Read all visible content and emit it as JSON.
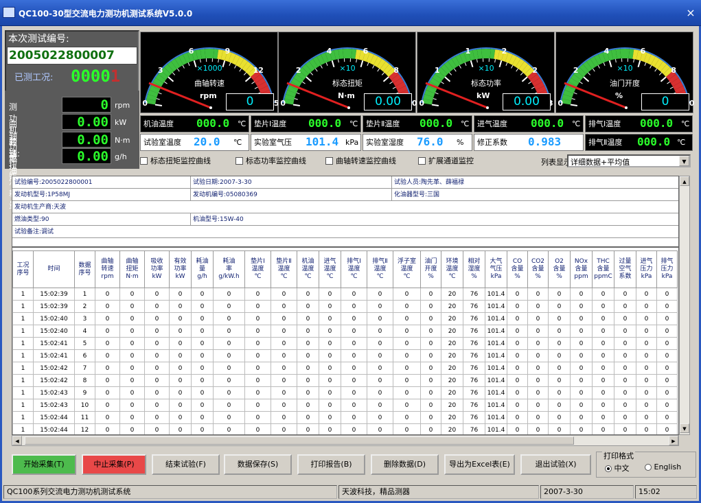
{
  "window": {
    "title": "QC100-30型交流电力测功机测试系统V5.0.0",
    "close": "×"
  },
  "left": {
    "test_no_label": "本次测试编号:",
    "test_no": "2005022800007",
    "tested_label": "已测工况:",
    "tested_value": "0000",
    "tested_last_digit": "1",
    "meters": [
      {
        "label": "测功机转速:",
        "value": "0",
        "unit": "rpm"
      },
      {
        "label": "曲轴功率",
        "value": "0.00",
        "unit": "kW"
      },
      {
        "label": "曲轴扭矩",
        "value": "0.00",
        "unit": "N·m"
      },
      {
        "label": "燃油消耗量:",
        "value": "0.00",
        "unit": "g/h"
      }
    ]
  },
  "gauges": [
    {
      "multiplier": "×1000",
      "name": "曲轴转速",
      "unit": "rpm",
      "value": "0",
      "ticks": [
        "0",
        "3",
        "6",
        "9",
        "12",
        "15"
      ]
    },
    {
      "multiplier": "×10",
      "name": "标态扭矩",
      "unit": "N·m",
      "value": "0.00",
      "ticks": [
        "0",
        "2",
        "4",
        "6",
        "8",
        "10"
      ]
    },
    {
      "multiplier": "×10",
      "name": "标态功率",
      "unit": "kW",
      "value": "0.00",
      "ticks": [
        "0",
        "1",
        "1",
        "2",
        "2",
        "3"
      ]
    },
    {
      "multiplier": "×10",
      "name": "油门开度",
      "unit": "%",
      "value": "0",
      "ticks": [
        "0",
        "2",
        "4",
        "6",
        "8",
        "10"
      ]
    }
  ],
  "readouts_row1": [
    {
      "label": "机油温度",
      "value": "000.0",
      "unit": "℃"
    },
    {
      "label": "垫片Ⅰ温度",
      "value": "000.0",
      "unit": "℃"
    },
    {
      "label": "垫片Ⅱ温度",
      "value": "000.0",
      "unit": "℃"
    },
    {
      "label": "进气温度",
      "value": "000.0",
      "unit": "℃"
    },
    {
      "label": "排气Ⅰ温度",
      "value": "000.0",
      "unit": "℃"
    }
  ],
  "readouts_row2": [
    {
      "label": "试验室温度",
      "value": "20.0",
      "unit": "℃"
    },
    {
      "label": "实验室气压",
      "value": "101.4",
      "unit": "kPa"
    },
    {
      "label": "实验室湿度",
      "value": "76.0",
      "unit": "%"
    },
    {
      "label": "修正系数",
      "value": "0.983",
      "unit": ""
    },
    {
      "label": "排气Ⅱ温度",
      "value": "000.0",
      "unit": "℃"
    }
  ],
  "checks": [
    "标态扭矩监控曲线",
    "标态功率监控曲线",
    "曲轴转速监控曲线",
    "扩展通道监控"
  ],
  "list_display": {
    "label": "列表显示:",
    "value": "详细数据+平均值"
  },
  "info": {
    "test_no": "试验编号:2005022800001",
    "date": "试验日期:2007-3-30",
    "staff": "试验人员:陶先革、薛福禄",
    "engine_model": "发动机型号:1P58MJ",
    "engine_no": "发动机编号:05080369",
    "carb": "化油器型号:三国",
    "maker": "发动机生产商:天波",
    "fuel": "燃油类型:90",
    "oil": "机油型号:15W-40",
    "note": "试验备注:调试"
  },
  "table": {
    "headers": [
      "工况\n序号",
      "时间",
      "数据\n序号",
      "曲轴\n转速\nrpm",
      "曲轴\n扭矩\nN·m",
      "吸收\n功率\nkW",
      "有效\n功率\nkW",
      "耗油\n量\ng/h",
      "耗油\n率\ng/kW.h",
      "垫片Ⅰ\n温度\n℃",
      "垫片Ⅱ\n温度\n℃",
      "机油\n温度\n℃",
      "进气\n温度\n℃",
      "排气Ⅰ\n温度\n℃",
      "排气Ⅱ\n温度\n℃",
      "浮子室\n温度\n℃",
      "油门\n开度\n%",
      "环境\n温度\n℃",
      "相对\n湿度\n%",
      "大气\n气压\nkPa",
      "CO\n含量\n%",
      "CO2\n含量\n%",
      "O2\n含量\n%",
      "NOx\n含量\nppm",
      "THC\n含量\nppmC",
      "过量\n空气\n系数",
      "进气\n压力\nkPa",
      "排气\n压力\nkPa"
    ],
    "rows": [
      [
        "1",
        "15:02:39",
        "1",
        "0",
        "0",
        "0",
        "0",
        "0",
        "0",
        "0",
        "0",
        "0",
        "0",
        "0",
        "0",
        "0",
        "0",
        "20",
        "76",
        "101.4",
        "0",
        "0",
        "0",
        "0",
        "0",
        "0",
        "0",
        "0"
      ],
      [
        "1",
        "15:02:39",
        "2",
        "0",
        "0",
        "0",
        "0",
        "0",
        "0",
        "0",
        "0",
        "0",
        "0",
        "0",
        "0",
        "0",
        "0",
        "20",
        "76",
        "101.4",
        "0",
        "0",
        "0",
        "0",
        "0",
        "0",
        "0",
        "0"
      ],
      [
        "1",
        "15:02:40",
        "3",
        "0",
        "0",
        "0",
        "0",
        "0",
        "0",
        "0",
        "0",
        "0",
        "0",
        "0",
        "0",
        "0",
        "0",
        "20",
        "76",
        "101.4",
        "0",
        "0",
        "0",
        "0",
        "0",
        "0",
        "0",
        "0"
      ],
      [
        "1",
        "15:02:40",
        "4",
        "0",
        "0",
        "0",
        "0",
        "0",
        "0",
        "0",
        "0",
        "0",
        "0",
        "0",
        "0",
        "0",
        "0",
        "20",
        "76",
        "101.4",
        "0",
        "0",
        "0",
        "0",
        "0",
        "0",
        "0",
        "0"
      ],
      [
        "1",
        "15:02:41",
        "5",
        "0",
        "0",
        "0",
        "0",
        "0",
        "0",
        "0",
        "0",
        "0",
        "0",
        "0",
        "0",
        "0",
        "0",
        "20",
        "76",
        "101.4",
        "0",
        "0",
        "0",
        "0",
        "0",
        "0",
        "0",
        "0"
      ],
      [
        "1",
        "15:02:41",
        "6",
        "0",
        "0",
        "0",
        "0",
        "0",
        "0",
        "0",
        "0",
        "0",
        "0",
        "0",
        "0",
        "0",
        "0",
        "20",
        "76",
        "101.4",
        "0",
        "0",
        "0",
        "0",
        "0",
        "0",
        "0",
        "0"
      ],
      [
        "1",
        "15:02:42",
        "7",
        "0",
        "0",
        "0",
        "0",
        "0",
        "0",
        "0",
        "0",
        "0",
        "0",
        "0",
        "0",
        "0",
        "0",
        "20",
        "76",
        "101.4",
        "0",
        "0",
        "0",
        "0",
        "0",
        "0",
        "0",
        "0"
      ],
      [
        "1",
        "15:02:42",
        "8",
        "0",
        "0",
        "0",
        "0",
        "0",
        "0",
        "0",
        "0",
        "0",
        "0",
        "0",
        "0",
        "0",
        "0",
        "20",
        "76",
        "101.4",
        "0",
        "0",
        "0",
        "0",
        "0",
        "0",
        "0",
        "0"
      ],
      [
        "1",
        "15:02:43",
        "9",
        "0",
        "0",
        "0",
        "0",
        "0",
        "0",
        "0",
        "0",
        "0",
        "0",
        "0",
        "0",
        "0",
        "0",
        "20",
        "76",
        "101.4",
        "0",
        "0",
        "0",
        "0",
        "0",
        "0",
        "0",
        "0"
      ],
      [
        "1",
        "15:02:43",
        "10",
        "0",
        "0",
        "0",
        "0",
        "0",
        "0",
        "0",
        "0",
        "0",
        "0",
        "0",
        "0",
        "0",
        "0",
        "20",
        "76",
        "101.4",
        "0",
        "0",
        "0",
        "0",
        "0",
        "0",
        "0",
        "0"
      ],
      [
        "1",
        "15:02:44",
        "11",
        "0",
        "0",
        "0",
        "0",
        "0",
        "0",
        "0",
        "0",
        "0",
        "0",
        "0",
        "0",
        "0",
        "0",
        "20",
        "76",
        "101.4",
        "0",
        "0",
        "0",
        "0",
        "0",
        "0",
        "0",
        "0"
      ],
      [
        "1",
        "15:02:44",
        "12",
        "0",
        "0",
        "0",
        "0",
        "0",
        "0",
        "0",
        "0",
        "0",
        "0",
        "0",
        "0",
        "0",
        "0",
        "20",
        "76",
        "101.4",
        "0",
        "0",
        "0",
        "0",
        "0",
        "0",
        "0",
        "0"
      ]
    ]
  },
  "buttons": [
    {
      "label": "开始采集(T)",
      "color": "#4dbb4d"
    },
    {
      "label": "中止采集(P)",
      "color": "#e84848"
    },
    {
      "label": "结束试验(F)",
      "color": ""
    },
    {
      "label": "数据保存(S)",
      "color": ""
    },
    {
      "label": "打印报告(B)",
      "color": ""
    },
    {
      "label": "删除数据(D)",
      "color": ""
    },
    {
      "label": "导出为Excel表(E)",
      "color": ""
    },
    {
      "label": "退出试验(X)",
      "color": ""
    }
  ],
  "print_format": {
    "label": "打印格式",
    "cn": "中文",
    "en": "English"
  },
  "status": [
    "QC100系列交流电力测功机测试系统",
    "天波科技，精品测器",
    "2007-3-30",
    "15:02"
  ]
}
